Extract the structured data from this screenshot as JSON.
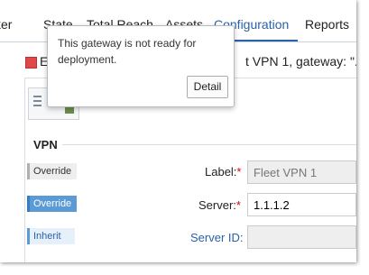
{
  "tabs": [
    {
      "label": "ker"
    },
    {
      "label": "State"
    },
    {
      "label": "Total Reach"
    },
    {
      "label": "Assets"
    },
    {
      "label": "Configuration",
      "active": true
    },
    {
      "label": "Reports"
    }
  ],
  "title": {
    "lead": "E",
    "rest": "t VPN 1, gateway: \"."
  },
  "section": {
    "title": "VPN"
  },
  "fields": [
    {
      "pill": "Override",
      "label": "Label:",
      "required": "*",
      "value": "Fleet VPN 1"
    },
    {
      "pill": "Override",
      "label": "Server:",
      "required": "*",
      "value": "1.1.1.2"
    },
    {
      "pill": "Inherit",
      "label": "Server ID:",
      "required": "",
      "value": ""
    }
  ],
  "popup": {
    "message": "This gateway is not ready for deployment.",
    "detail_label": "Detail"
  },
  "colors": {
    "accent": "#2a62a8",
    "status_red": "#e0484a",
    "override_blue": "#5b9bd5"
  }
}
